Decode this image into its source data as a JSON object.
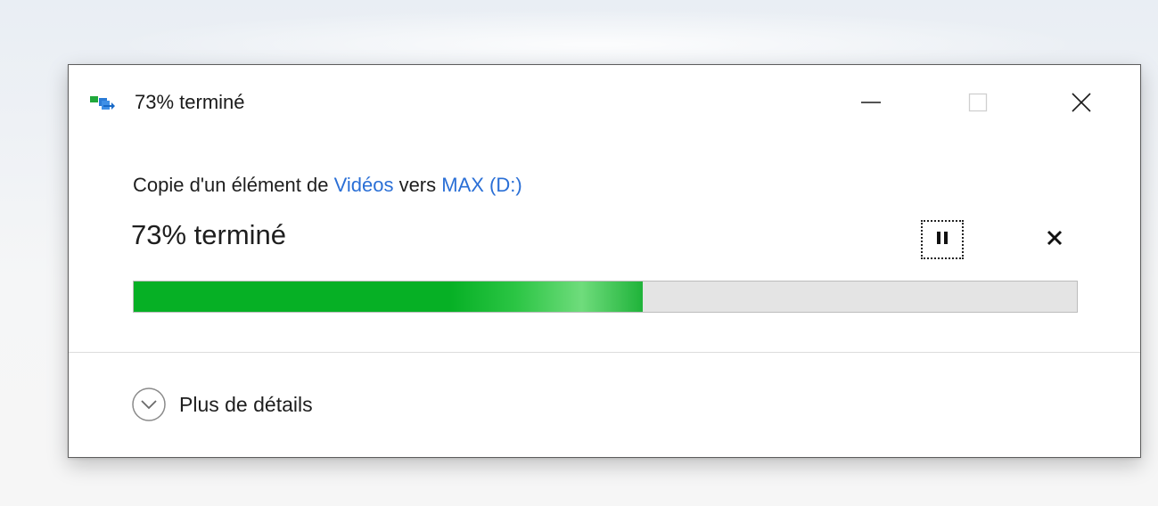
{
  "window": {
    "title": "73% terminé",
    "controls": {
      "minimize_icon": "minimize-icon",
      "maximize_icon": "maximize-icon",
      "close_icon": "close-icon"
    }
  },
  "copy": {
    "prefix": "Copie d'un élément de ",
    "source": "Vidéos",
    "middle": " vers ",
    "destination": "MAX (D:)",
    "link_color": "#2a6fd6"
  },
  "progress": {
    "label": "73% terminé",
    "value_percent": 54,
    "bar_color": "#06b025",
    "track_color": "#e4e4e4"
  },
  "actions": {
    "pause_icon": "pause-icon",
    "cancel_icon": "cancel-icon"
  },
  "footer": {
    "details_label": "Plus de détails",
    "details_icon": "chevron-down-circle-icon"
  }
}
